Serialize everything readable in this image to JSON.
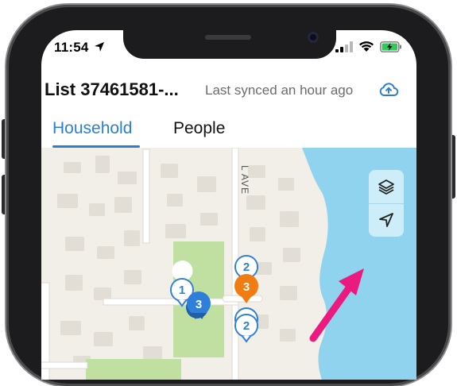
{
  "status_bar": {
    "time": "11:54"
  },
  "header": {
    "title": "List 37461581-...",
    "sync_status": "Last synced an hour ago"
  },
  "tabs": [
    {
      "label": "Household",
      "active": true
    },
    {
      "label": "People",
      "active": false
    }
  ],
  "map": {
    "street_label": "L AVE",
    "clusters": [
      {
        "count": "1",
        "style": "outline"
      },
      {
        "count": "2",
        "style": "outline"
      },
      {
        "count": "3",
        "style": "filled-orange"
      },
      {
        "count": "3",
        "style": "filled-blue"
      },
      {
        "count": "2",
        "style": "outline"
      }
    ],
    "controls": [
      "layers-icon",
      "location-arrow-icon"
    ]
  },
  "colors": {
    "accent": "#2b7fd0",
    "cluster_orange": "#f07c12",
    "cluster_blue": "#2d7fd9",
    "water": "#8fd3ee",
    "park": "#bfe0a0",
    "annotation_arrow": "#ea1a7f"
  }
}
